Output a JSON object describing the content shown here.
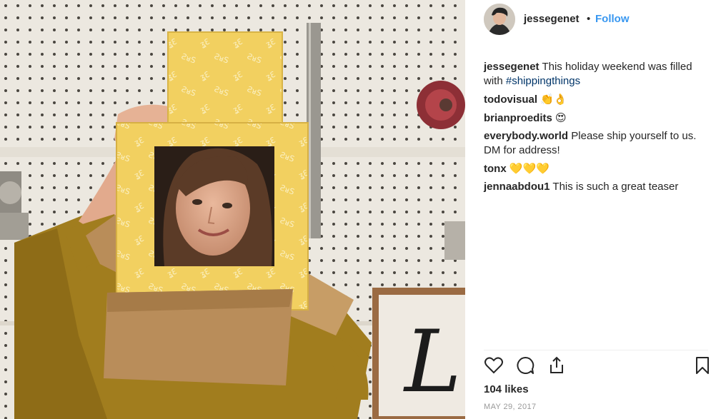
{
  "post": {
    "username": "jessegenet",
    "separator": "•",
    "follow_label": "Follow",
    "caption": {
      "user": "jessegenet",
      "text": "This holiday weekend was filled with",
      "hashtag": "#shippingthings"
    },
    "comments": [
      {
        "user": "todovisual",
        "text": "",
        "emoji": "👏👌"
      },
      {
        "user": "brianproedits",
        "text": "",
        "emoji": "😍"
      },
      {
        "user": "everybody.world",
        "text": "Please ship yourself to us. DM for address!",
        "emoji": ""
      },
      {
        "user": "tonx",
        "text": "",
        "emoji": "💛💛💛"
      },
      {
        "user": "jennaabdou1",
        "text": "This is such a great teaser",
        "emoji": ""
      }
    ],
    "likes": "104 likes",
    "date": "MAY 29, 2017",
    "icons": {
      "like": "heart-icon",
      "comment": "comment-bubble-icon",
      "share": "share-icon",
      "save": "bookmark-icon"
    },
    "colors": {
      "follow": "#3897f0",
      "hashtag": "#003569",
      "meta": "#999999"
    }
  }
}
